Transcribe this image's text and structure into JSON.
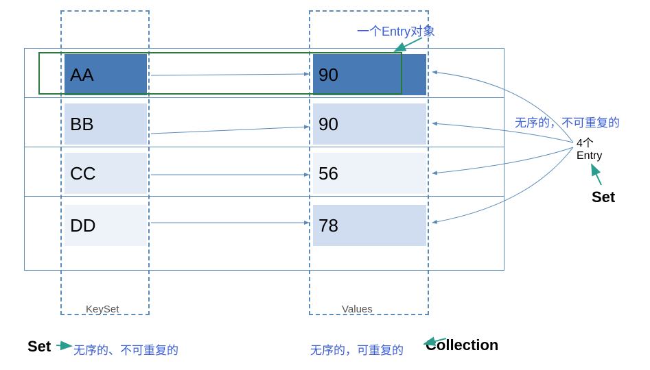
{
  "chart_data": {
    "type": "table",
    "rows": [
      {
        "key": "AA",
        "value": 90
      },
      {
        "key": "BB",
        "value": 90
      },
      {
        "key": "CC",
        "value": 56
      },
      {
        "key": "DD",
        "value": 78
      }
    ]
  },
  "labels": {
    "entry_object": "一个Entry对象",
    "unordered_unique": "无序的，不可重复的",
    "four_entry": "4个\nEntry",
    "set": "Set",
    "keyset": "KeySet",
    "values": "Values",
    "bottom_set": "Set",
    "bottom_set_desc": "无序的、不可重复的",
    "bottom_col_desc": "无序的，可重复的",
    "collection": "Collection"
  },
  "colors": {
    "blue_text": "#3c5fd6",
    "border": "#5b8bb8",
    "green_border": "#2b7a3d",
    "arrow_teal": "#2b9d8f"
  }
}
